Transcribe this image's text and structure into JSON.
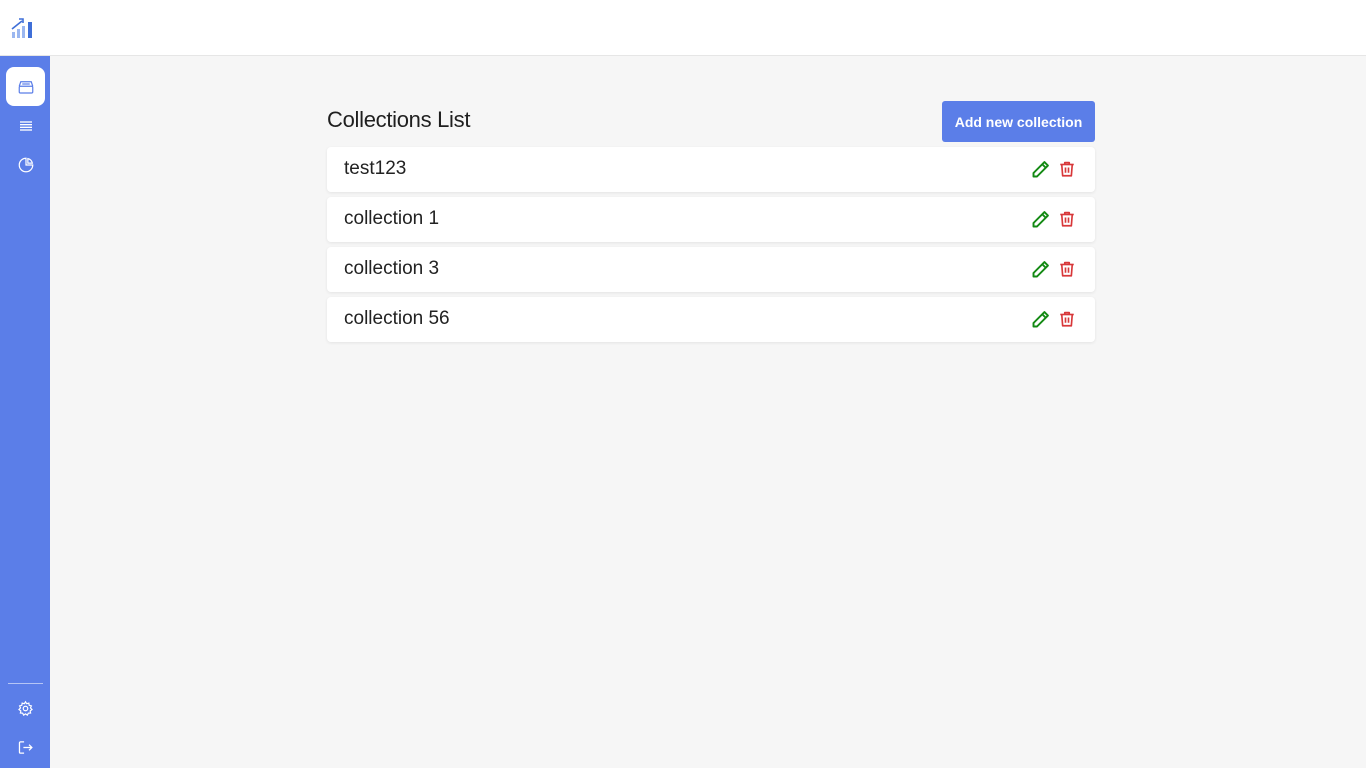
{
  "app": {
    "logo_icon": "bar-chart-logo-icon"
  },
  "sidebar": {
    "items": [
      {
        "name": "collections",
        "icon": "archive-box-icon",
        "active": true
      },
      {
        "name": "list",
        "icon": "list-lines-icon",
        "active": false
      },
      {
        "name": "stats",
        "icon": "pie-chart-icon",
        "active": false
      }
    ],
    "bottom_items": [
      {
        "name": "settings",
        "icon": "gear-icon"
      },
      {
        "name": "logout",
        "icon": "logout-icon"
      }
    ]
  },
  "main": {
    "title": "Collections List",
    "add_button_label": "Add new collection",
    "collections": [
      {
        "name": "test123"
      },
      {
        "name": "collection 1"
      },
      {
        "name": "collection 3"
      },
      {
        "name": "collection 56"
      }
    ]
  },
  "colors": {
    "accent": "#5b7ee8",
    "edit": "#138a13",
    "delete": "#d8383a",
    "background": "#f6f6f6"
  }
}
